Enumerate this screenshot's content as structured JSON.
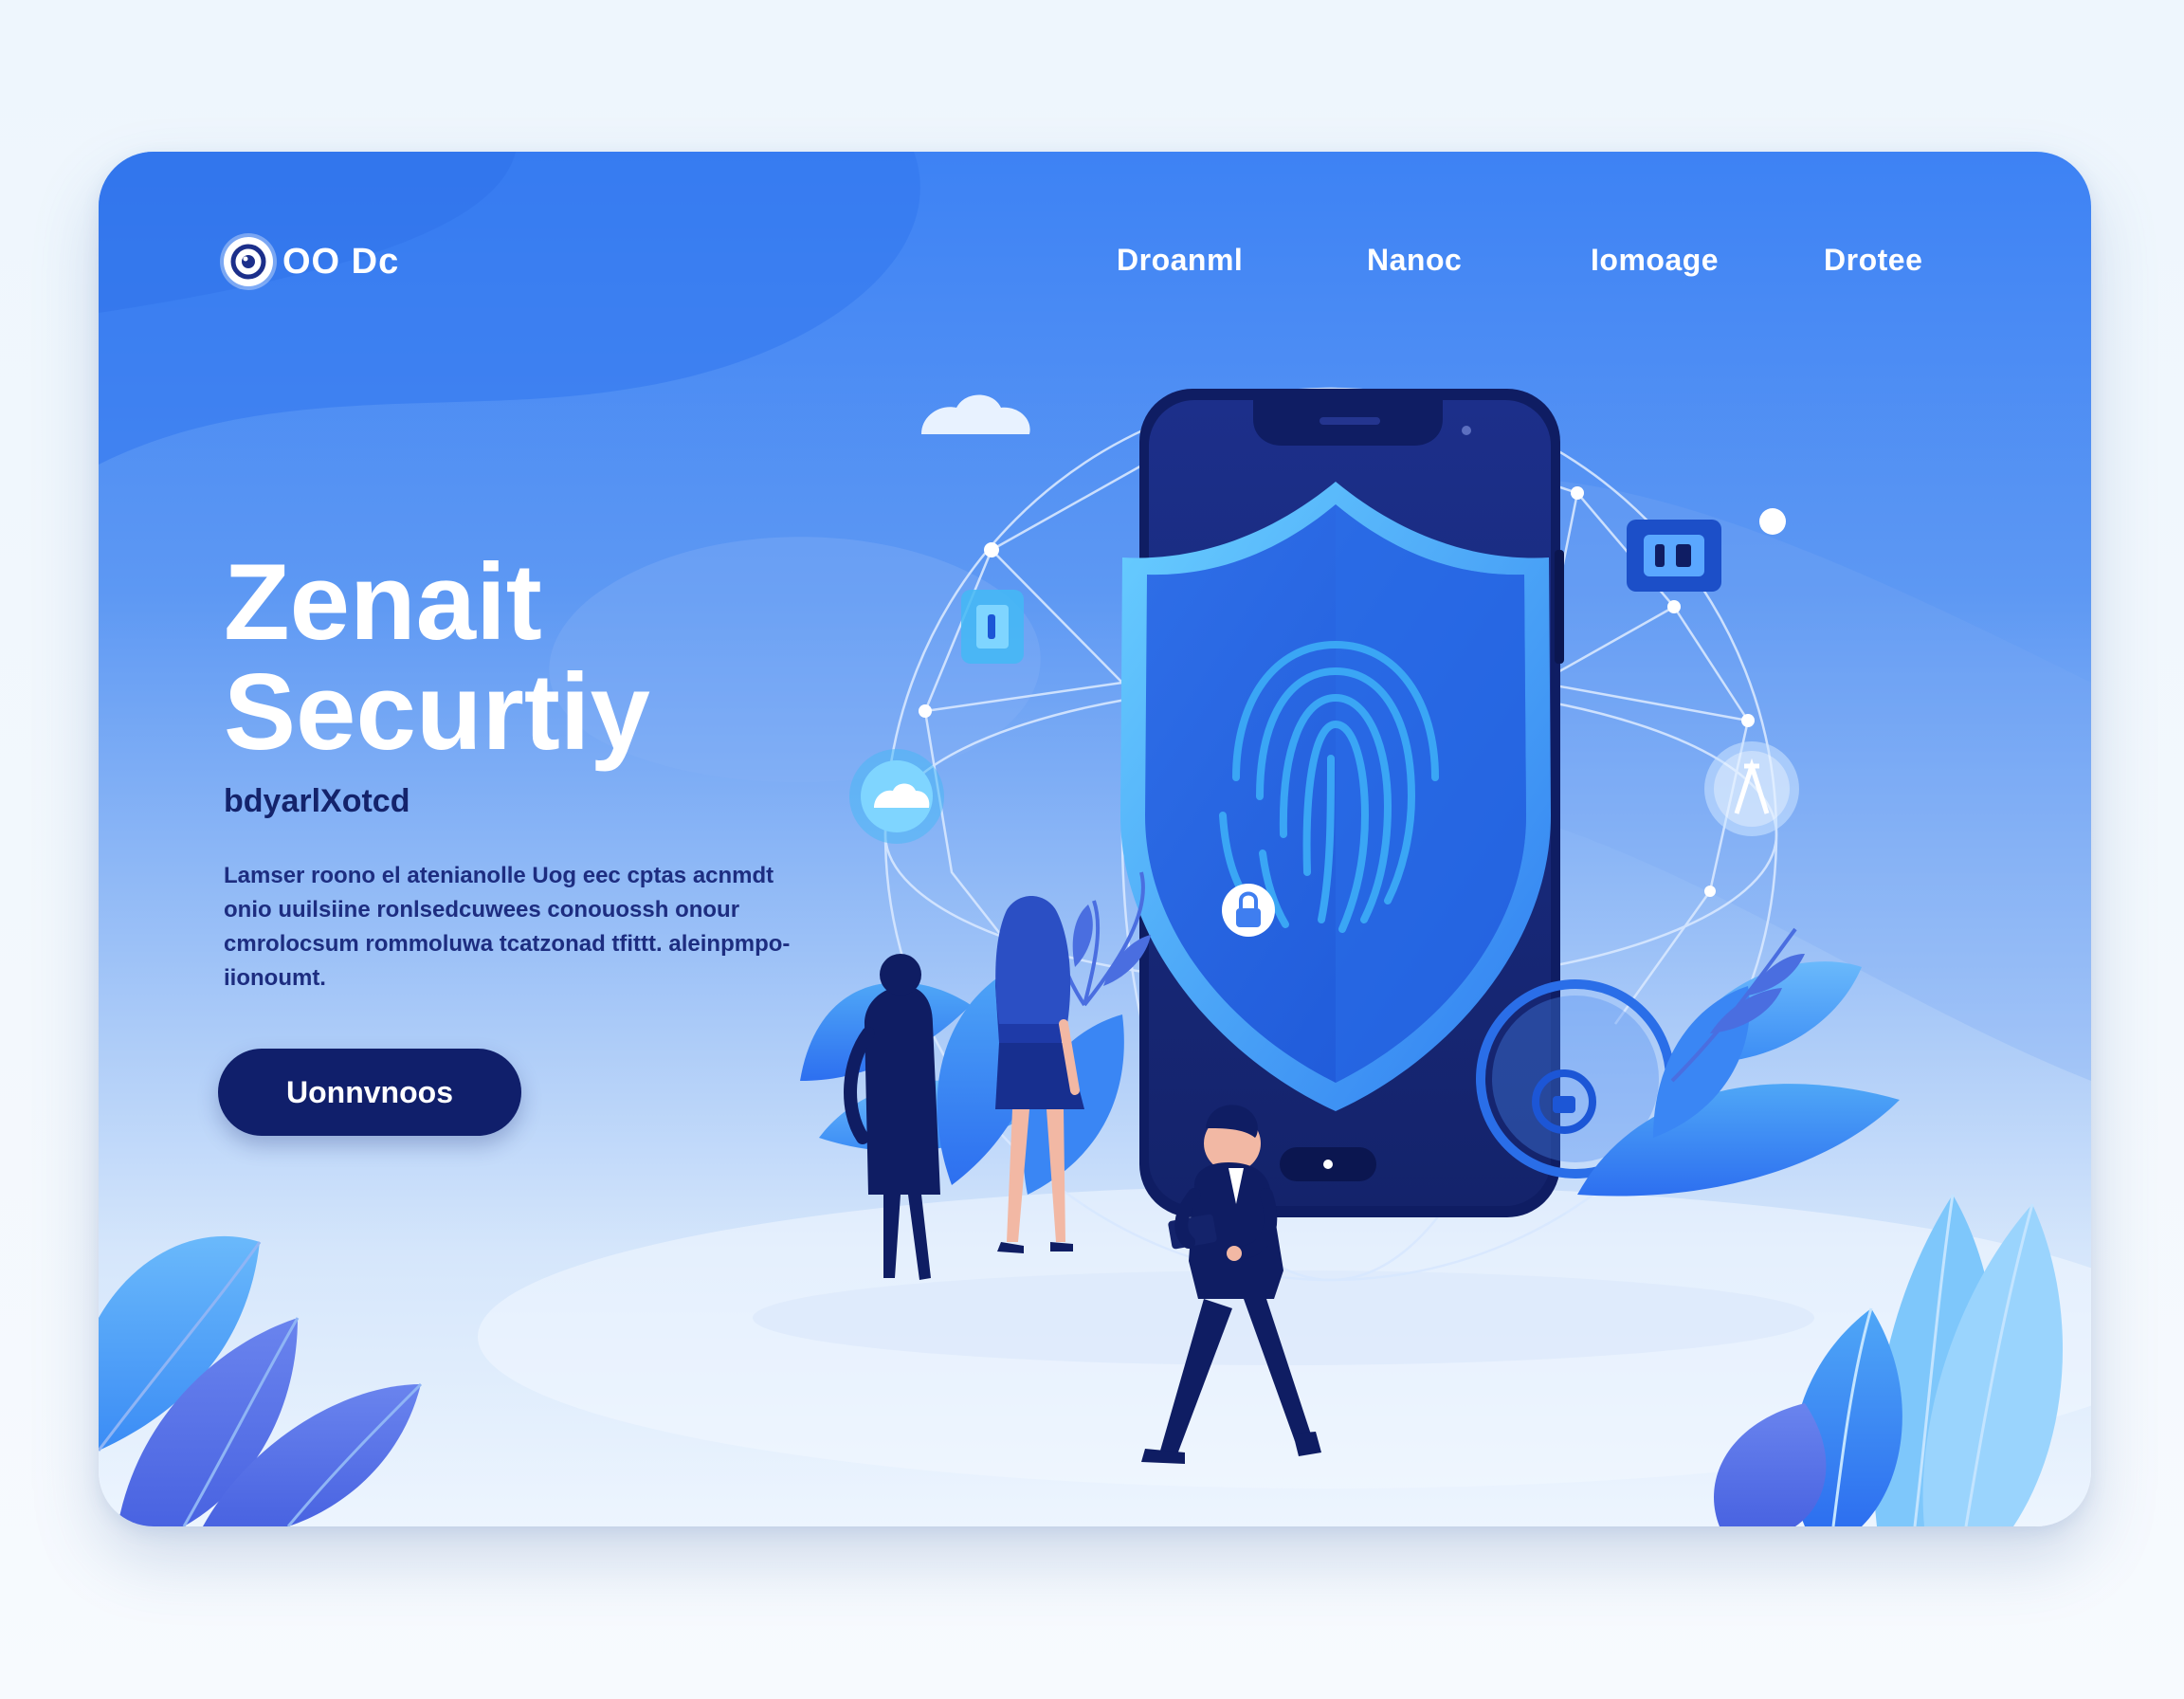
{
  "brand": {
    "logo_text": "OO Dc",
    "logo_icon": "eye-icon"
  },
  "nav": {
    "items": [
      {
        "label": "Droanml"
      },
      {
        "label": "Nanoc"
      },
      {
        "label": "Iomoage"
      },
      {
        "label": "Drotee"
      }
    ]
  },
  "hero": {
    "title_line1": "Zenait",
    "title_line2": "Securtiy",
    "subtitle": "bdyarlXotcd",
    "body": "Lamser roono el atenianolle Uog eec cptas acnmdt onio uuilsiine ronlsedcuwees conouossh onour cmrolocsum rommoluwa tcatzonad tfittt. aleinpmpo-iionoumt.",
    "cta_label": "Uonnvnoos"
  },
  "illustration": {
    "icons": [
      "cloud-icon",
      "shield-icon",
      "fingerprint-icon",
      "lock-icon",
      "document-icon",
      "cloud-badge-icon",
      "key-badge-icon",
      "padlock-badge-icon",
      "small-lock-icon"
    ]
  },
  "colors": {
    "card_top": "#3d82f4",
    "card_bottom": "#edf5fe",
    "navy": "#101f6b",
    "accent": "#43b8f5",
    "white": "#ffffff"
  }
}
